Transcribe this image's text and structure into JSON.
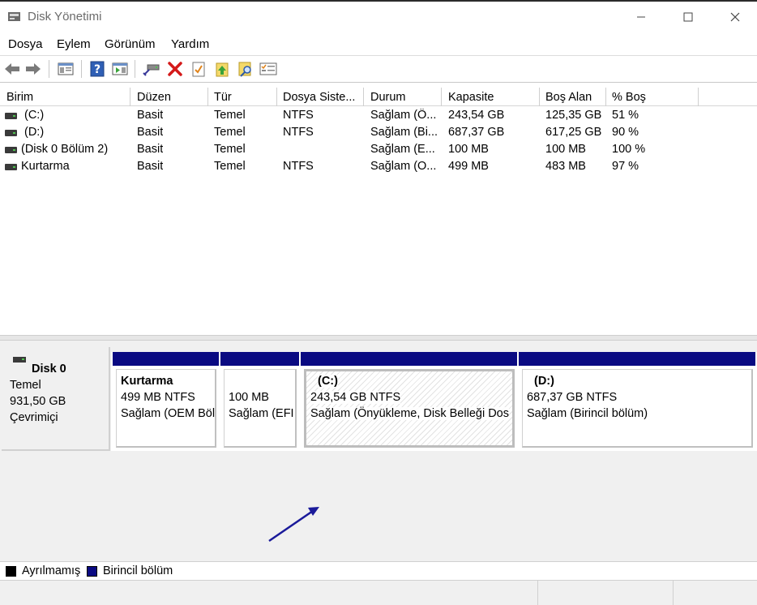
{
  "window": {
    "title": "Disk Yönetimi"
  },
  "menu": [
    "Dosya",
    "Eylem",
    "Görünüm",
    "Yardım"
  ],
  "toolbar": {
    "icons": [
      "back-arrow-icon",
      "forward-arrow-icon",
      "show-hide-console-tree-icon",
      "help-icon",
      "action-pane-icon",
      "connect-drive-icon",
      "delete-icon",
      "properties-icon",
      "up-icon",
      "search-icon",
      "list-view-icon"
    ]
  },
  "volumes": {
    "columns": [
      "Birim",
      "Düzen",
      "Tür",
      "Dosya Siste...",
      "Durum",
      "Kapasite",
      "Boş Alan",
      "% Boş"
    ],
    "rows": [
      [
        "(C:)",
        "Basit",
        "Temel",
        "NTFS",
        "Sağlam (Ö...",
        "243,54 GB",
        "125,35 GB",
        "51 %"
      ],
      [
        "(D:)",
        "Basit",
        "Temel",
        "NTFS",
        "Sağlam (Bi...",
        "687,37 GB",
        "617,25 GB",
        "90 %"
      ],
      [
        "(Disk 0 Bölüm 2)",
        "Basit",
        "Temel",
        "",
        "Sağlam (E...",
        "100 MB",
        "100 MB",
        "100 %"
      ],
      [
        "Kurtarma",
        "Basit",
        "Temel",
        "NTFS",
        "Sağlam (O...",
        "499 MB",
        "483 MB",
        "97 %"
      ]
    ]
  },
  "disk": {
    "name": "Disk 0",
    "type": "Temel",
    "size": "931,50 GB",
    "status": "Çevrimiçi",
    "partitions": [
      {
        "name": "Kurtarma",
        "size": "499 MB NTFS",
        "status": "Sağlam (OEM Böl"
      },
      {
        "name": "",
        "size": "100 MB",
        "status": "Sağlam (EFI"
      },
      {
        "name": "(C:)",
        "size": "243,54 GB NTFS",
        "status": "Sağlam (Önyükleme, Disk Belleği Dos"
      },
      {
        "name": "(D:)",
        "size": "687,37 GB NTFS",
        "status": "Sağlam (Birincil bölüm)"
      }
    ]
  },
  "legend": {
    "unallocated": "Ayrılmamış",
    "primary": "Birincil bölüm",
    "unallocated_color": "#000000",
    "primary_color": "#0a0a82"
  },
  "annotation": {
    "arrow_color": "#1a1a9a"
  }
}
